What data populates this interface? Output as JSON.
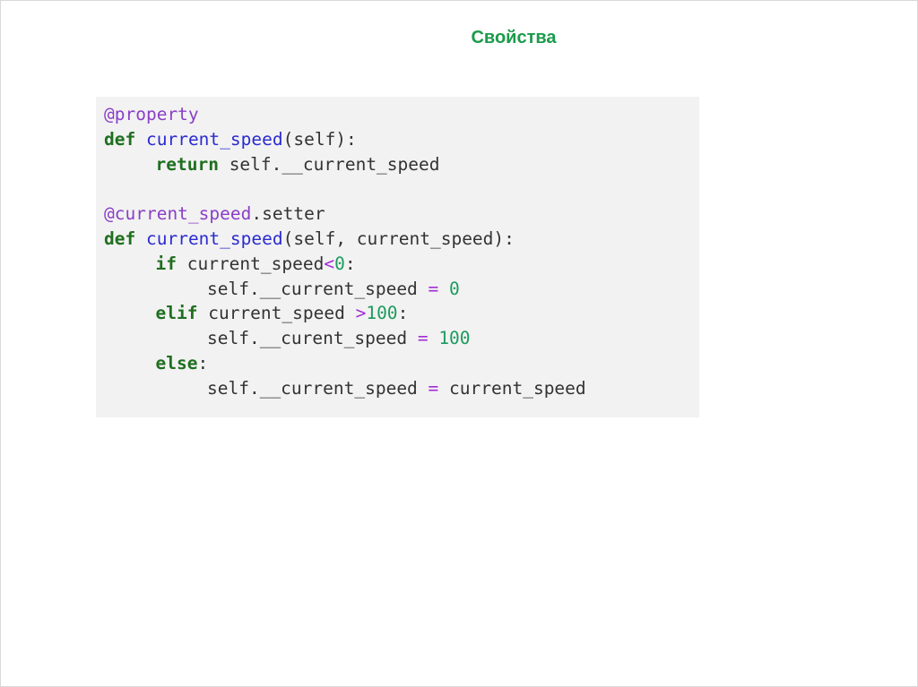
{
  "slide": {
    "title": "Свойства"
  },
  "code": {
    "lines": [
      {
        "tokens": [
          {
            "t": "dec",
            "v": "@property"
          }
        ]
      },
      {
        "tokens": [
          {
            "t": "kw",
            "v": "def"
          },
          {
            "t": "plain",
            "v": " "
          },
          {
            "t": "fn",
            "v": "current_speed"
          },
          {
            "t": "plain",
            "v": "(self):"
          }
        ]
      },
      {
        "indent": 1,
        "tokens": [
          {
            "t": "kw",
            "v": "return"
          },
          {
            "t": "plain",
            "v": " self.__current_speed"
          }
        ]
      },
      {
        "tokens": []
      },
      {
        "tokens": [
          {
            "t": "dec",
            "v": "@current_speed"
          },
          {
            "t": "plain",
            "v": ".setter"
          }
        ]
      },
      {
        "tokens": [
          {
            "t": "kw",
            "v": "def"
          },
          {
            "t": "plain",
            "v": " "
          },
          {
            "t": "fn",
            "v": "current_speed"
          },
          {
            "t": "plain",
            "v": "(self, current_speed):"
          }
        ]
      },
      {
        "indent": 1,
        "tokens": [
          {
            "t": "kw",
            "v": "if"
          },
          {
            "t": "plain",
            "v": " current_speed"
          },
          {
            "t": "op",
            "v": "<"
          },
          {
            "t": "num",
            "v": "0"
          },
          {
            "t": "plain",
            "v": ":"
          }
        ]
      },
      {
        "indent": 2,
        "tokens": [
          {
            "t": "plain",
            "v": "self.__current_speed "
          },
          {
            "t": "op",
            "v": "="
          },
          {
            "t": "plain",
            "v": " "
          },
          {
            "t": "num",
            "v": "0"
          }
        ]
      },
      {
        "indent": 1,
        "tokens": [
          {
            "t": "kw",
            "v": "elif"
          },
          {
            "t": "plain",
            "v": " current_speed "
          },
          {
            "t": "op",
            "v": ">"
          },
          {
            "t": "num",
            "v": "100"
          },
          {
            "t": "plain",
            "v": ":"
          }
        ]
      },
      {
        "indent": 2,
        "tokens": [
          {
            "t": "plain",
            "v": "self.__curent_speed "
          },
          {
            "t": "op",
            "v": "="
          },
          {
            "t": "plain",
            "v": " "
          },
          {
            "t": "num",
            "v": "100"
          }
        ]
      },
      {
        "indent": 1,
        "tokens": [
          {
            "t": "kw",
            "v": "else"
          },
          {
            "t": "plain",
            "v": ":"
          }
        ]
      },
      {
        "indent": 2,
        "tokens": [
          {
            "t": "plain",
            "v": "self.__current_speed "
          },
          {
            "t": "op",
            "v": "="
          },
          {
            "t": "plain",
            "v": " current_speed"
          }
        ]
      }
    ]
  },
  "colors": {
    "title": "#1a9b4b",
    "code_background": "#f2f2f2",
    "keyword": "#1f6f1f",
    "function_name": "#2b2bd1",
    "decorator": "#8a3fc7",
    "operator": "#a42cd6",
    "number": "#1c9b5e"
  }
}
